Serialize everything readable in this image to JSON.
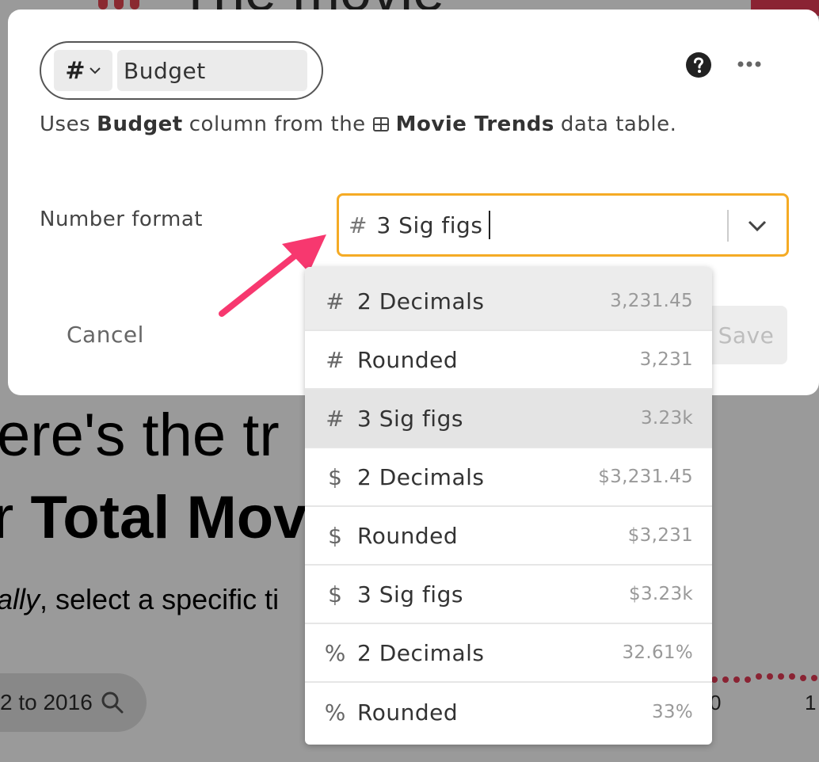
{
  "background": {
    "title_fragment": "The movie",
    "heading_line1": "ere's the tr",
    "heading_line2_prefix": "r ",
    "heading_line2_bold": "Total Mov",
    "subtext_italic": "ally",
    "subtext_rest": ", select a specific ti",
    "date_range": "2 to 2016",
    "axis_label_a": "0",
    "axis_label_b": "1",
    "accent_color": "#8a2333"
  },
  "modal": {
    "column_type_icon": "#",
    "column_name": "Budget",
    "description": {
      "prefix": "Uses",
      "column": "Budget",
      "middle": "column from the",
      "table": "Movie Trends",
      "suffix": "data table."
    },
    "number_format_label": "Number format",
    "select": {
      "icon": "#",
      "value": "3 Sig figs",
      "border_color": "#f5ab25"
    },
    "cancel_label": "Cancel",
    "save_label": "Save"
  },
  "dropdown": {
    "options": [
      {
        "icon": "#",
        "label": "2 Decimals",
        "sample": "3,231.45"
      },
      {
        "icon": "#",
        "label": "Rounded",
        "sample": "3,231"
      },
      {
        "icon": "#",
        "label": "3 Sig figs",
        "sample": "3.23k",
        "selected": true
      },
      {
        "icon": "$",
        "label": "2 Decimals",
        "sample": "$3,231.45"
      },
      {
        "icon": "$",
        "label": "Rounded",
        "sample": "$3,231"
      },
      {
        "icon": "$",
        "label": "3 Sig figs",
        "sample": "$3.23k"
      },
      {
        "icon": "%",
        "label": "2 Decimals",
        "sample": "32.61%"
      },
      {
        "icon": "%",
        "label": "Rounded",
        "sample": "33%"
      }
    ]
  },
  "annotation_color": "#f7386f"
}
